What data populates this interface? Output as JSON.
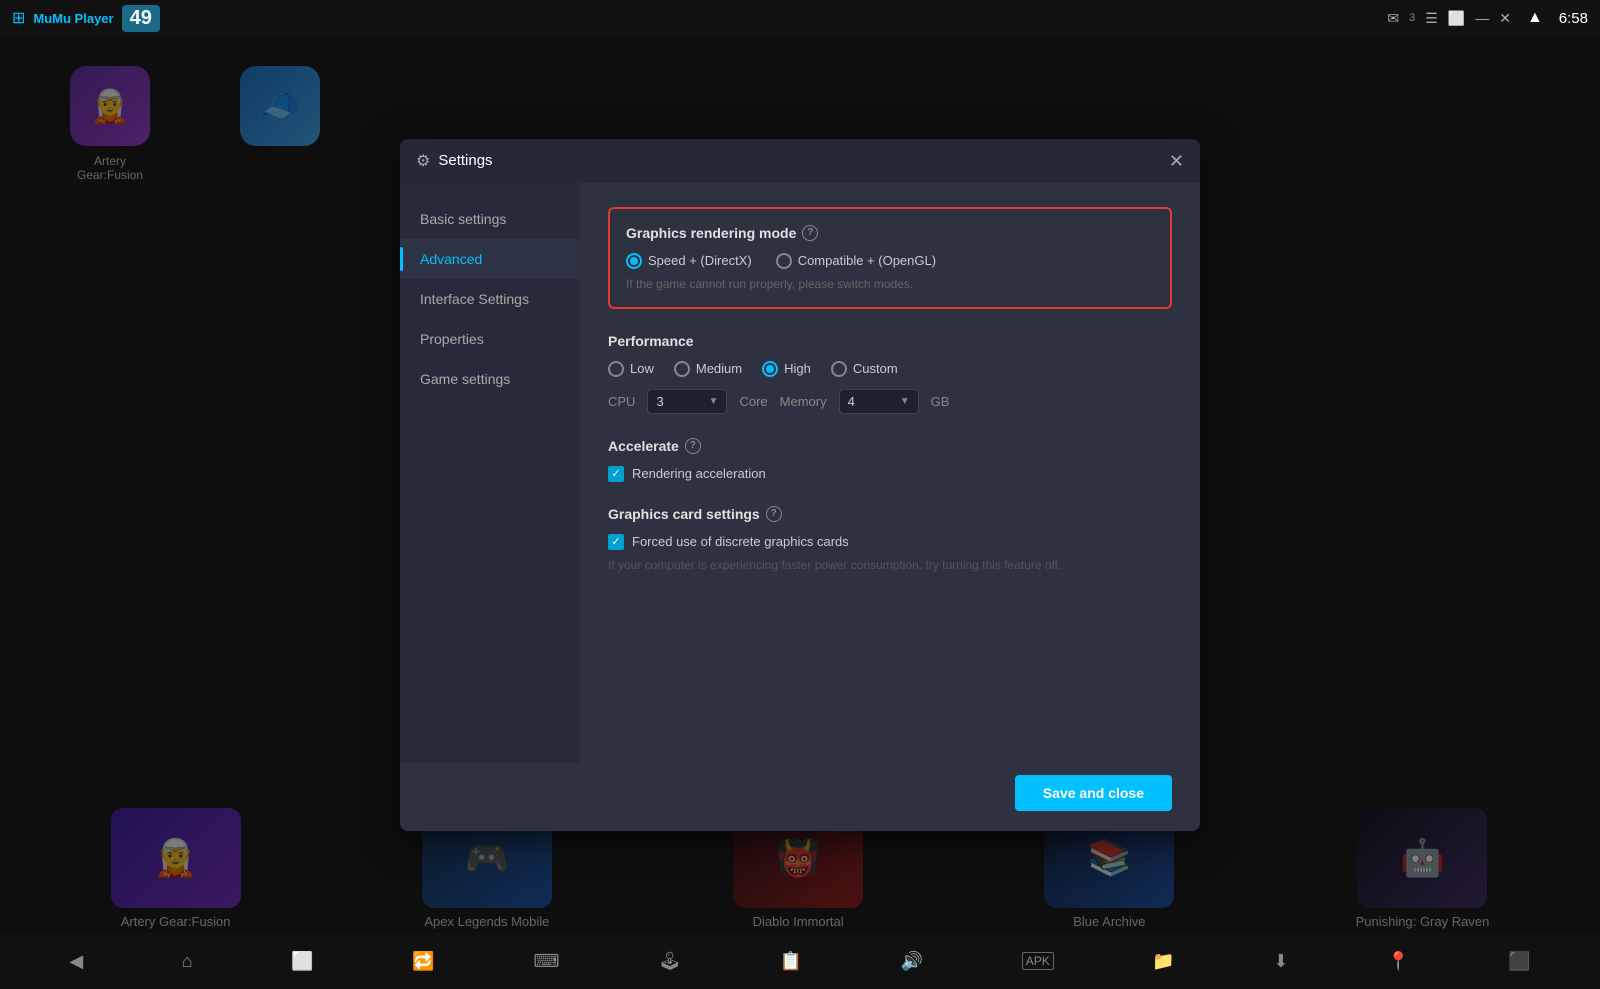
{
  "topbar": {
    "app_name": "MuMu Player",
    "badge_number": "49",
    "time": "6:58",
    "notification_count": "3"
  },
  "sidebar": {
    "items": [
      {
        "id": "basic",
        "label": "Basic settings",
        "active": false
      },
      {
        "id": "advanced",
        "label": "Advanced",
        "active": true
      },
      {
        "id": "interface",
        "label": "Interface Settings",
        "active": false
      },
      {
        "id": "properties",
        "label": "Properties",
        "active": false
      },
      {
        "id": "game",
        "label": "Game settings",
        "active": false
      }
    ]
  },
  "dialog": {
    "title": "Settings",
    "close_label": "✕"
  },
  "rendering_mode": {
    "section_title": "Graphics rendering mode",
    "options": [
      {
        "id": "speed",
        "label": "Speed + (DirectX)",
        "selected": true
      },
      {
        "id": "compatible",
        "label": "Compatible + (OpenGL)",
        "selected": false
      }
    ],
    "hint": "If the game cannot run properly, please switch modes."
  },
  "performance": {
    "section_title": "Performance",
    "levels": [
      {
        "id": "low",
        "label": "Low",
        "selected": false
      },
      {
        "id": "medium",
        "label": "Medium",
        "selected": false
      },
      {
        "id": "high",
        "label": "High",
        "selected": true
      },
      {
        "id": "custom",
        "label": "Custom",
        "selected": false
      }
    ],
    "cpu_label": "CPU",
    "cpu_value": "3",
    "core_label": "Core",
    "memory_label": "Memory",
    "memory_value": "4",
    "gb_label": "GB"
  },
  "accelerate": {
    "section_title": "Accelerate",
    "rendering_acceleration_label": "Rendering acceleration",
    "rendering_acceleration_checked": true
  },
  "gpu_settings": {
    "section_title": "Graphics card settings",
    "discrete_gpu_label": "Forced use of discrete graphics cards",
    "discrete_gpu_checked": true,
    "warning_text": "If your computer is experiencing faster power consumption, try turning this feature off."
  },
  "footer": {
    "save_label": "Save and close"
  },
  "games": [
    {
      "id": "artery",
      "label": "Artery Gear:Fusion",
      "emoji": "🧝"
    },
    {
      "id": "apex",
      "label": "Apex Legends Mobile",
      "emoji": "🎮"
    },
    {
      "id": "diablo",
      "label": "Diablo Immortal",
      "emoji": "👹"
    },
    {
      "id": "blue",
      "label": "Blue Archive",
      "emoji": "📚"
    },
    {
      "id": "punishing",
      "label": "Punishing: Gray Raven",
      "emoji": "🤖"
    }
  ],
  "taskbar_icons": [
    "◀",
    "⌂",
    "⬜",
    "🔁",
    "⌨",
    "🎮",
    "📋",
    "🔊",
    "APK",
    "📁",
    "⬇",
    "📍",
    "⬛"
  ]
}
